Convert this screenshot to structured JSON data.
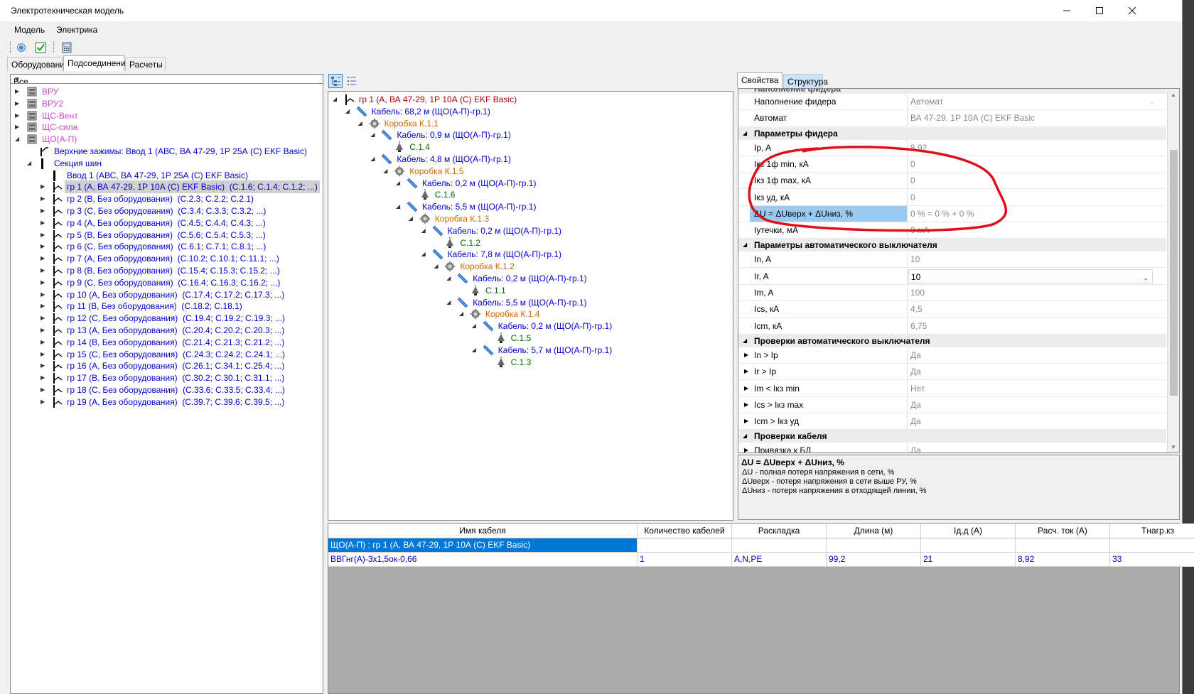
{
  "window": {
    "title": "Электротехническая модель"
  },
  "menu": [
    "Модель",
    "Электрика"
  ],
  "left_tabs": [
    "Оборудование",
    "Подсоединения",
    "Расчеты"
  ],
  "filter": {
    "value": "Все"
  },
  "left_tree": {
    "boards": [
      "ВРУ",
      "ВРУ2",
      "ЩС-Вент",
      "ЩС-сила",
      "ЩО(А-П)"
    ],
    "top_clamps": "Верхние зажимы: Ввод 1 (АВС, ВА 47-29, 1Р 25А (С) EKF Basic)",
    "bus_section": "Секция шин",
    "input": "Ввод 1 (АВС, ВА 47-29, 1Р 25А (С) EKF Basic)",
    "groups": [
      {
        "name": "гр 1 (А, ВА 47-29, 1Р 10А (С) EKF Basic)",
        "consumers": "(С.1.6; С.1.4; С.1.2; ...)"
      },
      {
        "name": "гр 2 (В, Без оборудования)",
        "consumers": "(С.2.3; С.2.2; С.2.1)"
      },
      {
        "name": "гр 3 (С, Без оборудования)",
        "consumers": "(С.3.4; С.3.3; С.3.2; ...)"
      },
      {
        "name": "гр 4 (А, Без оборудования)",
        "consumers": "(С.4.5; С.4.4; С.4.3; ...)"
      },
      {
        "name": "гр 5 (В, Без оборудования)",
        "consumers": "(С.5.6; С.5.4; С.5.3; ...)"
      },
      {
        "name": "гр 6 (С, Без оборудования)",
        "consumers": "(С.6.1; С.7.1; С.8.1; ...)"
      },
      {
        "name": "гр 7 (А, Без оборудования)",
        "consumers": "(С.10.2; С.10.1; С.11.1; ...)"
      },
      {
        "name": "гр 8 (В, Без оборудования)",
        "consumers": "(С.15.4; С.15.3; С.15.2; ...)"
      },
      {
        "name": "гр 9 (С, Без оборудования)",
        "consumers": "(С.16.4; С.16.3; С.16.2; ...)"
      },
      {
        "name": "гр 10 (А, Без оборудования)",
        "consumers": "(С.17.4; С.17.2; С.17.3; ...)"
      },
      {
        "name": "гр 11 (В, Без оборудования)",
        "consumers": "(С.18.2; С.18.1)"
      },
      {
        "name": "гр 12 (С, Без оборудования)",
        "consumers": "(С.19.4; С.19.2; С.19.3; ...)"
      },
      {
        "name": "гр 13 (А, Без оборудования)",
        "consumers": "(С.20.4; С.20.2; С.20.3; ...)"
      },
      {
        "name": "гр 14 (В, Без оборудования)",
        "consumers": "(С.21.4; С.21.3; С.21.2; ...)"
      },
      {
        "name": "гр 15 (С, Без оборудования)",
        "consumers": "(С.24.3; С.24.2; С.24.1; ...)"
      },
      {
        "name": "гр 16 (А, Без оборудования)",
        "consumers": "(С.26.1; С.34.1; С.25.4; ...)"
      },
      {
        "name": "гр 17 (В, Без оборудования)",
        "consumers": "(С.30.2; С.30.1; С.31.1; ...)"
      },
      {
        "name": "гр 18 (С, Без оборудования)",
        "consumers": "(С.33.6; С.33.5; С.33.4; ...)"
      },
      {
        "name": "гр 19 (А, Без оборудования)",
        "consumers": "(С.39.7; С.39.6; С.39.5; ...)"
      }
    ]
  },
  "mid_tree": [
    {
      "text": "гр 1 (А, ВА 47-29, 1Р 10А (С) EKF Basic)",
      "kind": "group",
      "level": 0
    },
    {
      "text": "Кабель: 68,2 м (ЩО(А-П)-гр.1)",
      "kind": "cable",
      "level": 1
    },
    {
      "text": "Коробка К.1.1",
      "kind": "box",
      "level": 2
    },
    {
      "text": "Кабель: 0,9 м (ЩО(А-П)-гр.1)",
      "kind": "cable",
      "level": 3
    },
    {
      "text": "С.1.4",
      "kind": "lamp",
      "level": 4
    },
    {
      "text": "Кабель: 4,8 м (ЩО(А-П)-гр.1)",
      "kind": "cable",
      "level": 3
    },
    {
      "text": "Коробка К.1.5",
      "kind": "box",
      "level": 4
    },
    {
      "text": "Кабель: 0,2 м (ЩО(А-П)-гр.1)",
      "kind": "cable",
      "level": 5
    },
    {
      "text": "С.1.6",
      "kind": "lamp",
      "level": 6
    },
    {
      "text": "Кабель: 5,5 м (ЩО(А-П)-гр.1)",
      "kind": "cable",
      "level": 5
    },
    {
      "text": "Коробка К.1.3",
      "kind": "box",
      "level": 6
    },
    {
      "text": "Кабель: 0,2 м (ЩО(А-П)-гр.1)",
      "kind": "cable",
      "level": 7
    },
    {
      "text": "С.1.2",
      "kind": "lamp",
      "level": 8
    },
    {
      "text": "Кабель: 7,8 м (ЩО(А-П)-гр.1)",
      "kind": "cable",
      "level": 7
    },
    {
      "text": "Коробка К.1.2",
      "kind": "box",
      "level": 8
    },
    {
      "text": "Кабель: 0,2 м (ЩО(А-П)-гр.1)",
      "kind": "cable",
      "level": 9
    },
    {
      "text": "С.1.1",
      "kind": "lamp",
      "level": 10
    },
    {
      "text": "Кабель: 5,5 м (ЩО(А-П)-гр.1)",
      "kind": "cable",
      "level": 9
    },
    {
      "text": "Коробка К.1.4",
      "kind": "box",
      "level": 10
    },
    {
      "text": "Кабель: 0,2 м (ЩО(А-П)-гр.1)",
      "kind": "cable",
      "level": 11
    },
    {
      "text": "С.1.5",
      "kind": "lamp",
      "level": 12
    },
    {
      "text": "Кабель: 5,7 м (ЩО(А-П)-гр.1)",
      "kind": "cable",
      "level": 11
    },
    {
      "text": "С.1.3",
      "kind": "lamp",
      "level": 12
    }
  ],
  "right_tabs": [
    "Свойства",
    "Структура"
  ],
  "props": {
    "cut_header": "Наполнение фидера",
    "rows": [
      {
        "type": "row",
        "name": "Наполнение фидера",
        "value": "Автомат",
        "dropdown": true
      },
      {
        "type": "row",
        "name": "Автомат",
        "value": "ВА 47-29, 1Р 10А (С) EKF Basic"
      },
      {
        "type": "cat",
        "name": "Параметры фидера"
      },
      {
        "type": "row",
        "name": "Ip, A",
        "value": "8,92"
      },
      {
        "type": "row",
        "name": "Iкз 1ф min, кА",
        "value": "0"
      },
      {
        "type": "row",
        "name": "Iкз 1ф max, кА",
        "value": "0"
      },
      {
        "type": "row",
        "name": "Iкз уд, кА",
        "value": "0"
      },
      {
        "type": "row",
        "name": "ΔU = ΔUверх + ΔUниз, %",
        "value": "0 % = 0 % + 0 %",
        "selected": true
      },
      {
        "type": "row",
        "name": "Iутечки, мА",
        "value": "0 мА"
      },
      {
        "type": "cat",
        "name": "Параметры автоматического выключателя"
      },
      {
        "type": "row",
        "name": "In, A",
        "value": "10"
      },
      {
        "type": "row",
        "name": "Ir, A",
        "value": "10",
        "dropdown": true,
        "editable": true
      },
      {
        "type": "row",
        "name": "Im, A",
        "value": "100"
      },
      {
        "type": "row",
        "name": "Ics, кА",
        "value": "4,5"
      },
      {
        "type": "row",
        "name": "Icm, кА",
        "value": "6,75"
      },
      {
        "type": "cat",
        "name": "Проверки автоматического выключателя"
      },
      {
        "type": "row",
        "name": "In > Ip",
        "value": "Да",
        "expander": true
      },
      {
        "type": "row",
        "name": "Ir > Ip",
        "value": "Да",
        "expander": true
      },
      {
        "type": "row",
        "name": "Im < Iкз min",
        "value": "Нет",
        "expander": true
      },
      {
        "type": "row",
        "name": "Ics > Iкз max",
        "value": "Да",
        "expander": true
      },
      {
        "type": "row",
        "name": "Icm > Iкз уд",
        "value": "Да",
        "expander": true
      },
      {
        "type": "cat",
        "name": "Проверки кабеля"
      },
      {
        "type": "row",
        "name": "Привязка к БД",
        "value": "Да",
        "expander": true
      }
    ]
  },
  "description": {
    "title": "ΔU = ΔUверх + ΔUниз, %",
    "lines": [
      "ΔU - полная потеря напряжения в сети, %",
      "ΔUверх - потеря напряжения в сети выше РУ, %",
      "ΔUниз - потеря напряжения в отходящей линии, %"
    ]
  },
  "cable_grid": {
    "columns": [
      "Имя кабеля",
      "Количество кабелей",
      "Раскладка",
      "Длина (м)",
      "Iд.д (А)",
      "Расч. ток (А)",
      "Тнагр.кз"
    ],
    "group_row": "ЩО(А-П) : гр 1 (А, ВА 47-29, 1Р 10А (С) EKF Basic)",
    "rows": [
      [
        "ВВГнг(А)-3х1,5ок-0,66",
        "1",
        "A,N,PE",
        "99,2",
        "21",
        "8,92",
        "33"
      ]
    ]
  },
  "colors": {
    "board": "#d048c8",
    "group": "#0000d0",
    "box": "#d06800",
    "lamp": "#007000",
    "root_group": "#b00000",
    "selection": "#99c9ef",
    "grid_select": "#0078d7",
    "annotation": "#e0101a"
  }
}
